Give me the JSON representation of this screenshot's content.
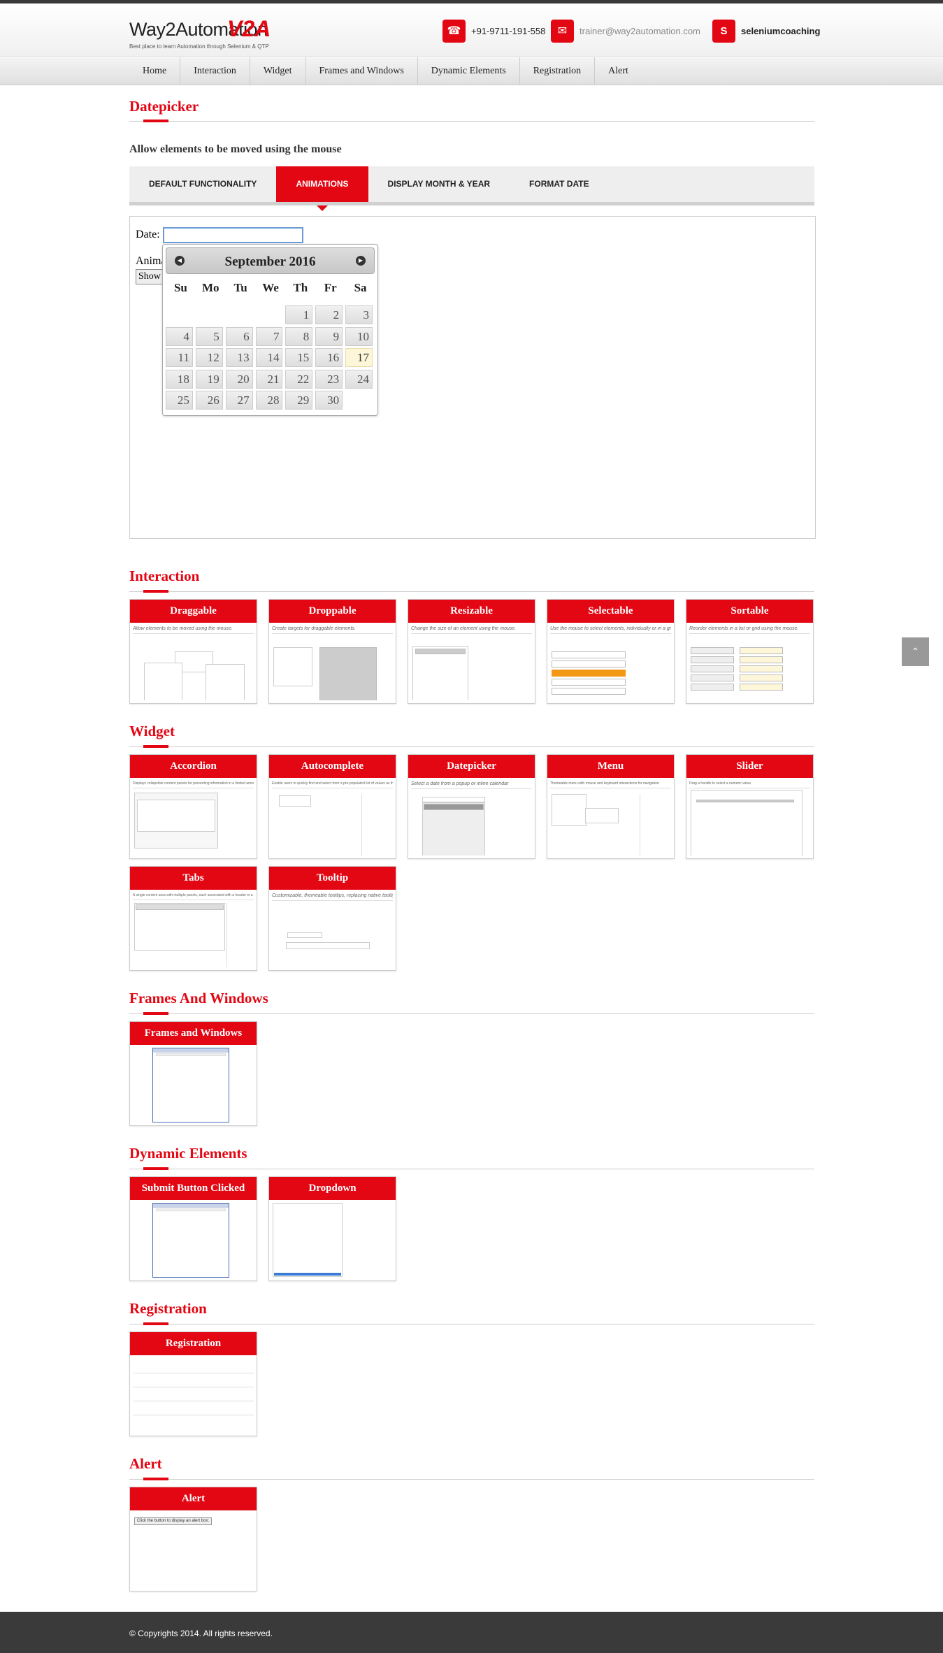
{
  "header": {
    "logo_text": "Way2Automation",
    "logo_mark": "V2A",
    "logo_tagline": "Best place to learn Automation through Selenium & QTP",
    "phone": "+91-9711-191-558",
    "email": "trainer@way2automation.com",
    "skype": "seleniumcoaching"
  },
  "nav": [
    "Home",
    "Interaction",
    "Widget",
    "Frames and Windows",
    "Dynamic Elements",
    "Registration",
    "Alert"
  ],
  "datepicker": {
    "title": "Datepicker",
    "subhead": "Allow elements to be moved using the mouse",
    "tabs": [
      "DEFAULT FUNCTIONALITY",
      "ANIMATIONS",
      "DISPLAY MONTH & YEAR",
      "FORMAT DATE"
    ],
    "active_tab": "ANIMATIONS",
    "date_label": "Date:",
    "date_value": "",
    "anim_label": "Anima",
    "show_label": "Show",
    "calendar": {
      "month_year": "September 2016",
      "days_of_week": [
        "Su",
        "Mo",
        "Tu",
        "We",
        "Th",
        "Fr",
        "Sa"
      ],
      "weeks": [
        [
          "",
          "",
          "",
          "",
          "1",
          "2",
          "3"
        ],
        [
          "4",
          "5",
          "6",
          "7",
          "8",
          "9",
          "10"
        ],
        [
          "11",
          "12",
          "13",
          "14",
          "15",
          "16",
          "17"
        ],
        [
          "18",
          "19",
          "20",
          "21",
          "22",
          "23",
          "24"
        ],
        [
          "25",
          "26",
          "27",
          "28",
          "29",
          "30",
          ""
        ]
      ],
      "today": "17"
    }
  },
  "sections": {
    "interaction": {
      "title": "Interaction",
      "cards": [
        {
          "title": "Draggable",
          "desc": "Allow elements to be moved using the mouse."
        },
        {
          "title": "Droppable",
          "desc": "Create targets for draggable elements."
        },
        {
          "title": "Resizable",
          "desc": "Change the size of an element using the mouse."
        },
        {
          "title": "Selectable",
          "desc": "Use the mouse to select elements, individually or in a group."
        },
        {
          "title": "Sortable",
          "desc": "Reorder elements in a list or grid using the mouse."
        }
      ]
    },
    "widget": {
      "title": "Widget",
      "cards": [
        {
          "title": "Accordion",
          "desc": "Displays collapsible content panels for presenting information in a limited amount of space."
        },
        {
          "title": "Autocomplete",
          "desc": "Enable users to quickly find and select from a pre-populated list of values as they type."
        },
        {
          "title": "Datepicker",
          "desc": "Select a date from a popup or inline calendar"
        },
        {
          "title": "Menu",
          "desc": "Themeable menu with mouse and keyboard interactions for navigation."
        },
        {
          "title": "Slider",
          "desc": "Drag a handle to select a numeric value."
        },
        {
          "title": "Tabs",
          "desc": "A single content area with multiple panels, each associated with a header in a list."
        },
        {
          "title": "Tooltip",
          "desc": "Customizable, themeable tooltips, replacing native tooltips."
        }
      ]
    },
    "frames": {
      "title": "Frames And Windows",
      "cards": [
        {
          "title": "Frames and Windows"
        }
      ]
    },
    "dynamic": {
      "title": "Dynamic Elements",
      "cards": [
        {
          "title": "Submit Button Clicked"
        },
        {
          "title": "Dropdown"
        }
      ]
    },
    "registration": {
      "title": "Registration",
      "cards": [
        {
          "title": "Registration"
        }
      ]
    },
    "alert": {
      "title": "Alert",
      "cards": [
        {
          "title": "Alert",
          "button": "Click the button to display an alert box:"
        }
      ]
    }
  },
  "footer": "© Copyrights 2014. All rights reserved.",
  "colors": {
    "brand": "#e30613",
    "footer": "#3a3a3a"
  }
}
